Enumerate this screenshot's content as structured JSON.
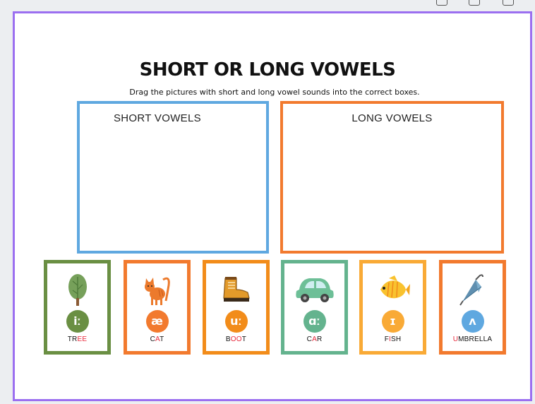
{
  "title": "SHORT OR LONG VOWELS",
  "subtitle": "Drag the pictures with short and long vowel sounds into the correct boxes.",
  "boxes": {
    "short_label": "SHORT VOWELS",
    "long_label": "LONG VOWELS"
  },
  "cards": [
    {
      "pre": "TR",
      "hl": "EE",
      "post": "",
      "symbol": "iː",
      "icon": "tree-icon",
      "border": "#6a8f43",
      "symbol_color": "#6a8f43"
    },
    {
      "pre": "C",
      "hl": "A",
      "post": "T",
      "symbol": "æ",
      "icon": "cat-icon",
      "border": "#f27a2e",
      "symbol_color": "#f27a2e"
    },
    {
      "pre": "B",
      "hl": "OO",
      "post": "T",
      "symbol": "uː",
      "icon": "boot-icon",
      "border": "#f28c1a",
      "symbol_color": "#f28c1a"
    },
    {
      "pre": "C",
      "hl": "A",
      "post": "R",
      "symbol": "ɑː",
      "icon": "car-icon",
      "border": "#64b38e",
      "symbol_color": "#64b38e"
    },
    {
      "pre": "F",
      "hl": "I",
      "post": "SH",
      "symbol": "ɪ",
      "icon": "fish-icon",
      "border": "#f9aa36",
      "symbol_color": "#f9aa36"
    },
    {
      "pre": "",
      "hl": "U",
      "post": "MBRELLA",
      "symbol": "ʌ",
      "icon": "umbrella-icon",
      "border": "#f27a2e",
      "symbol_color": "#5fa8e0"
    }
  ]
}
